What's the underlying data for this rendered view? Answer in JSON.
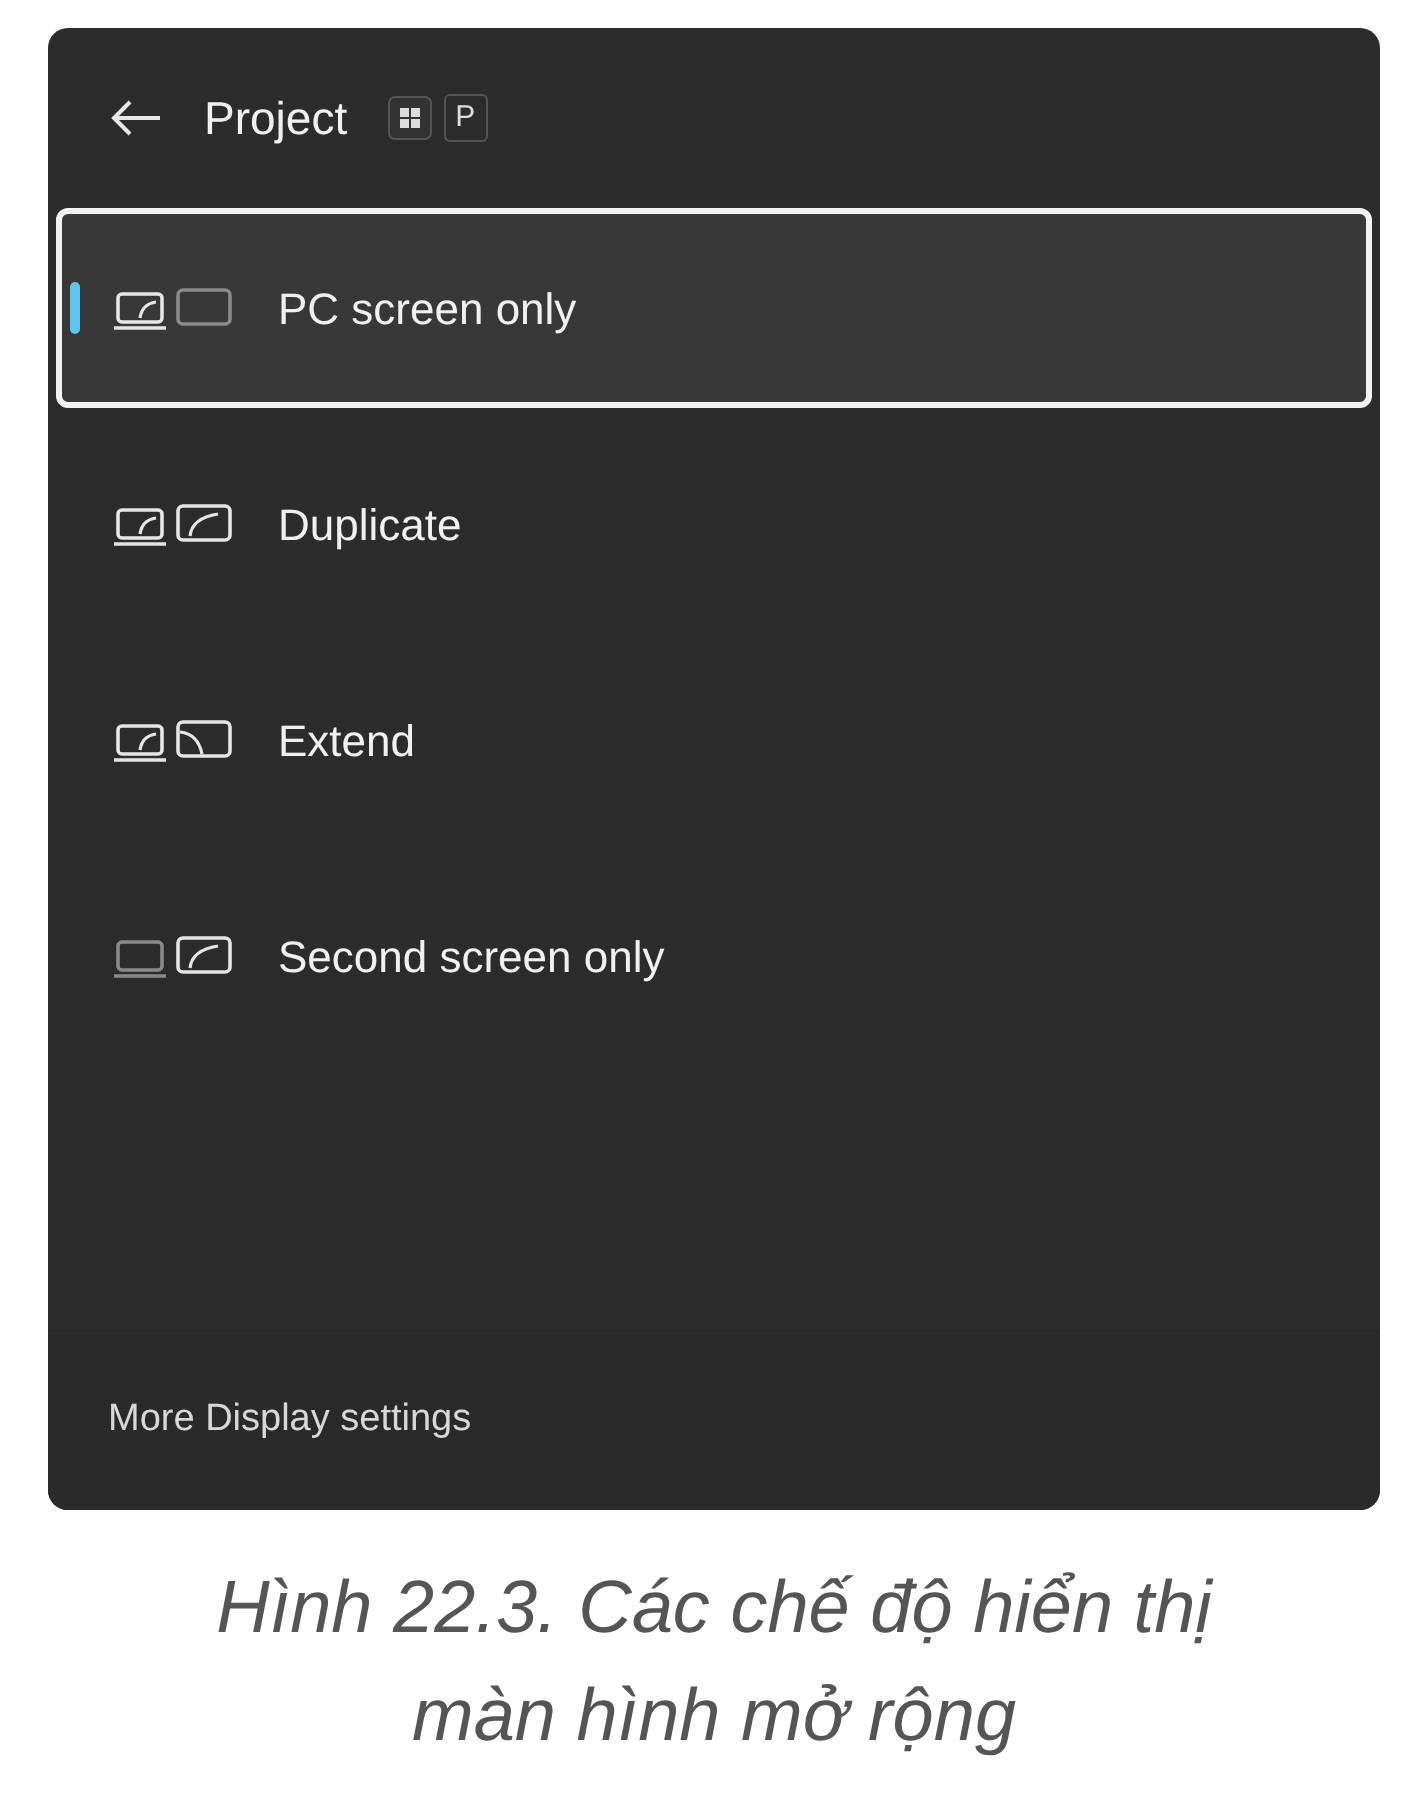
{
  "header": {
    "title": "Project",
    "shortcut_key": "P"
  },
  "modes": [
    {
      "kind": "pc_only",
      "label": "PC screen only",
      "selected": true
    },
    {
      "kind": "duplicate",
      "label": "Duplicate",
      "selected": false
    },
    {
      "kind": "extend",
      "label": "Extend",
      "selected": false
    },
    {
      "kind": "second_only",
      "label": "Second screen only",
      "selected": false
    }
  ],
  "footer": {
    "link": "More Display settings"
  },
  "caption": [
    "Hình 22.3. Các chế độ hiển thị",
    "màn hình mở rộng"
  ]
}
